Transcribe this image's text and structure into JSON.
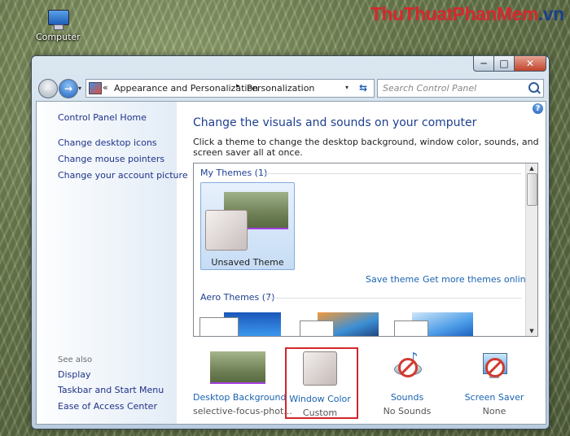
{
  "desktop": {
    "icon_label": "Computer"
  },
  "watermark": {
    "part1": "ThuThuat",
    "part2": "PhanMem",
    "part3": ".vn"
  },
  "window_controls": {
    "minimize": "─",
    "maximize": "□",
    "close": "✕"
  },
  "toolbar": {
    "back": "←",
    "forward": "→",
    "recent": "▾",
    "address_prefix": "«",
    "breadcrumb": [
      "Appearance and Personalization",
      "Personalization"
    ],
    "breadcrumb_sep": "▸",
    "address_dropdown": "▾",
    "refresh": "⇆",
    "search_placeholder": "Search Control Panel"
  },
  "sidebar": {
    "home": "Control Panel Home",
    "links": [
      "Change desktop icons",
      "Change mouse pointers",
      "Change your account picture"
    ],
    "see_also": "See also",
    "see_also_links": [
      "Display",
      "Taskbar and Start Menu",
      "Ease of Access Center"
    ]
  },
  "main": {
    "help": "?",
    "heading": "Change the visuals and sounds on your computer",
    "description": "Click a theme to change the desktop background, window color, sounds, and screen saver all at once.",
    "my_themes": "My Themes (1)",
    "unsaved_theme": "Unsaved Theme",
    "save_theme": "Save theme",
    "get_more": "Get more themes online",
    "aero_themes": "Aero Themes (7)"
  },
  "bottom_items": [
    {
      "label": "Desktop Background",
      "sub": "selective-focus-phot..."
    },
    {
      "label": "Window Color",
      "sub": "Custom"
    },
    {
      "label": "Sounds",
      "sub": "No Sounds"
    },
    {
      "label": "Screen Saver",
      "sub": "None"
    }
  ],
  "colors": {
    "link": "#1a63b0",
    "heading": "#1e3f8f",
    "highlight": "#d3262b",
    "nav_link": "#1e3287"
  }
}
